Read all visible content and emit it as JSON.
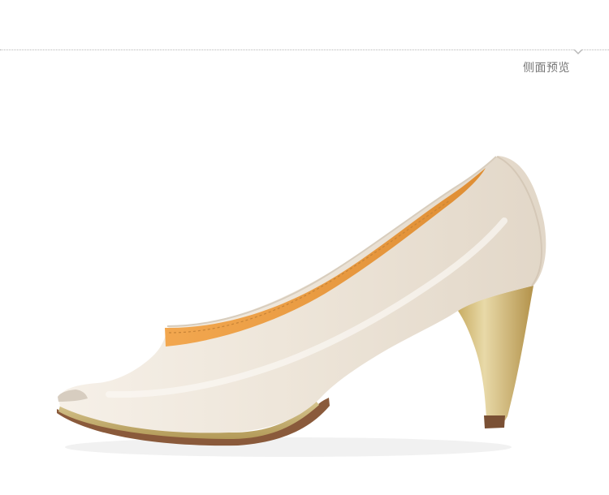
{
  "header": {
    "section_label": "侧面预览"
  },
  "image": {
    "subject": "shoe-side-view",
    "colors": {
      "upper": "#ece3d6",
      "lining": "#f0a24d",
      "heel_gold": "#d8c48e",
      "sole": "#8a5a3b"
    }
  }
}
